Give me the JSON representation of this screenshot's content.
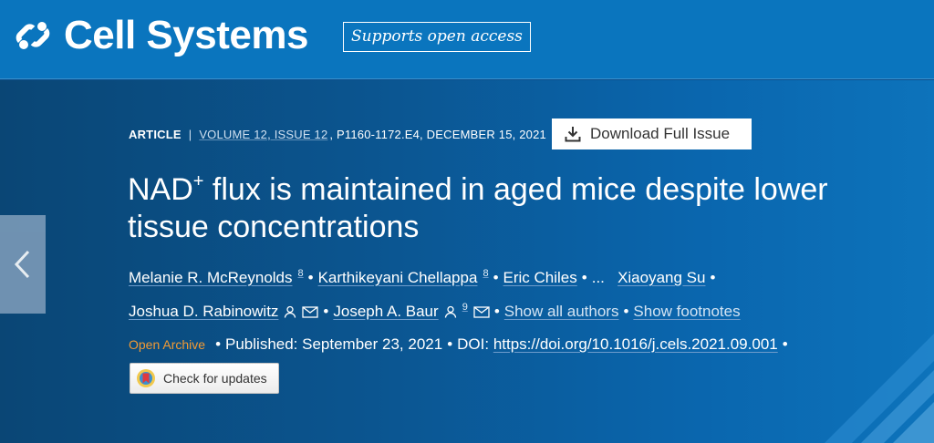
{
  "header": {
    "journal_name": "Cell Systems",
    "open_access_badge": "Supports open access"
  },
  "meta": {
    "article_type": "ARTICLE",
    "separator": "|",
    "issue_link": "VOLUME 12, ISSUE 12",
    "pages_date": ", P1160-1172.E4, DECEMBER 15, 2021",
    "download_label": "Download Full Issue"
  },
  "title": {
    "prefix": "NAD",
    "superscript": "+",
    "rest": " flux is maintained in aged mice despite lower tissue concentrations"
  },
  "authors": {
    "list": [
      {
        "name": "Melanie R. McReynolds",
        "aff": "8"
      },
      {
        "name": "Karthikeyani Chellappa",
        "aff": "8"
      },
      {
        "name": "Eric Chiles"
      },
      {
        "name": "Xiaoyang Su"
      },
      {
        "name": "Joshua D. Rabinowitz"
      },
      {
        "name": "Joseph A. Baur",
        "aff": "9"
      }
    ],
    "ellipsis": "...",
    "bullet": "•",
    "show_all_authors": "Show all authors",
    "show_footnotes": "Show footnotes"
  },
  "publication": {
    "access": "Open Archive",
    "published": "Published: September 23, 2021",
    "doi_label": "DOI:",
    "doi_link": "https://doi.org/10.1016/j.cels.2021.09.001"
  },
  "updates": {
    "check_label": "Check for updates"
  },
  "colors": {
    "topbar": "#0a75be",
    "hero_start": "#0a4675",
    "hero_end": "#0d73bb",
    "open_archive": "#f29a33"
  },
  "icons": {
    "logo": "cell-press-logo",
    "download": "download-icon",
    "person": "person-icon",
    "mail": "mail-icon",
    "prev": "chevron-left-icon",
    "updates": "crossmark-icon"
  }
}
